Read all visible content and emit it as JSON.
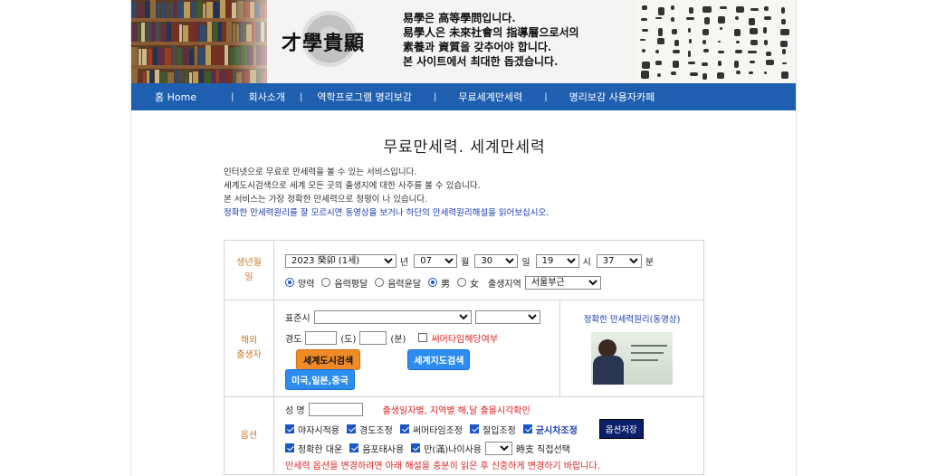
{
  "header": {
    "logo_text": "才學貴顯",
    "motto": [
      "易學은 高等學問입니다.",
      "易學人은 未來社會의 指導層으로서의",
      "素養과 資質을 갖추어야 합니다.",
      "본 사이트에서 최대한 돕겠습니다."
    ]
  },
  "nav": {
    "items": [
      "Home",
      "회사소개",
      "역학프로그램 명리보감",
      "무료세계만세력",
      "명리보감 사용자카페"
    ],
    "home_prefix": "홈"
  },
  "page": {
    "title": "무료만세력. 세계만세력",
    "intro": [
      "인터넷으로 무료로 만세력을 볼 수 있는 서비스입니다.",
      "세계도시검색으로 세계 모든 곳의 출생지에 대한 사주를 볼 수 있습니다.",
      "본 서비스는 가장 정확한 만세력으로 정평이 나 있습니다."
    ],
    "intro_link": "정확한 만세력원리를 잘 모르시면 동영상을 보거나 하단의 만세력원리해설을 읽어보십시오."
  },
  "birth": {
    "label_line1": "생년월",
    "label_line2": "일",
    "year": "2023 癸卯 (1세)",
    "year_unit": "년",
    "month": "07",
    "month_unit": "월",
    "day": "30",
    "day_unit": "일",
    "hour": "19",
    "hour_unit": "시",
    "minute": "37",
    "minute_unit": "분",
    "calendar_options": [
      "양력",
      "음력평달",
      "음력윤달"
    ],
    "calendar_selected": "양력",
    "gender_options": [
      "男",
      "女"
    ],
    "gender_selected": "男",
    "birthplace_label": "출생지역",
    "birthplace": "서울부근"
  },
  "overseas": {
    "label_line1": "해외",
    "label_line2": "출생자",
    "std_time_label": "표준시",
    "longitude_label": "경도",
    "deg_unit": "(도)",
    "min_unit": "(분)",
    "summer_time_label": "써머타임해당여부",
    "city_search_button": "세계도시검색",
    "map_search_button": "세계지도검색",
    "region_button": "미국,일본,중국",
    "video_link": "정확한 만세력원리(동영상)"
  },
  "options": {
    "label": "옵션",
    "name_label": "성 명",
    "name_note": "출생일자별, 지역별 해,달 출몰시각확인",
    "checks_row1": [
      "야자시적용",
      "경도조정",
      "써머타임조정",
      "절입조정",
      "균시차조정"
    ],
    "save_button": "옵션저장",
    "checks_row2": [
      "정확한 대운",
      "음포태사용",
      "만(滿)나이사용"
    ],
    "hour_pick_label": "時支 직접선택",
    "warning": "만세력 옵션을 변경하려면 아래 해설을 충분히 읽은 후 신중하게 변경하기 바랍니다."
  },
  "colors": {
    "nav_bg": "#1f5fb0",
    "label_orange": "#c87b2c",
    "accent_red": "#d22222",
    "link_blue": "#1a3bb0"
  }
}
